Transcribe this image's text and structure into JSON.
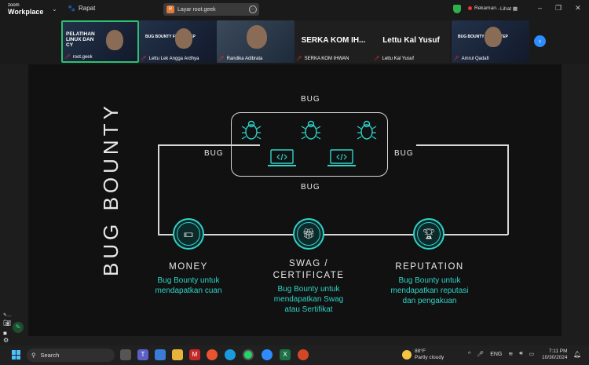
{
  "titlebar": {
    "logo_line1": "zoom",
    "logo_line2": "Workplace",
    "meeting_label": "Rapat",
    "share_label": "Layar root.geek",
    "share_badge": "R",
    "recording_label": "Rekaman...",
    "view_label": "Lihat"
  },
  "participants": [
    {
      "name": "root.geek",
      "overlay": "PELATIHAN LINUX DAN CY"
    },
    {
      "name": "Lettu Lek Angga Ardhya",
      "overlay": "BUG BOUNTY FIRST STEP"
    },
    {
      "name": "Randika Adibrata",
      "overlay": ""
    },
    {
      "name": "SERKA KOM IHWAN",
      "big": "SERKA KOM IH..."
    },
    {
      "name": "Lettu Kal Yusuf",
      "big": "Lettu Kal Yusuf"
    },
    {
      "name": "Amrul Qadafi",
      "overlay": "BUG BOUNTY FIRST STEP"
    }
  ],
  "slide": {
    "title": "BUG BOUNTY",
    "bug_top": "BUG",
    "bug_left": "BUG",
    "bug_right": "BUG",
    "bug_bottom": "BUG",
    "money_head": "MONEY",
    "money_desc": "Bug Bounty untuk mendapatkan cuan",
    "swag_head_1": "SWAG /",
    "swag_head_2": "CERTIFICATE",
    "swag_desc": "Bug Bounty untuk mendapatkan Swag atau Sertifikat",
    "rep_head": "REPUTATION",
    "rep_desc": "Bug Bounty untuk mendapatkan reputasi dan pengakuan"
  },
  "taskbar": {
    "search_label": "Search",
    "weather_temp": "88°F",
    "weather_desc": "Partly cloudy",
    "lang": "ENG",
    "time": "7:11 PM",
    "date": "10/30/2024"
  },
  "colors": {
    "accent": "#2fd3c7",
    "zoom_blue": "#2d8cff",
    "active_border": "#2fbf71"
  }
}
